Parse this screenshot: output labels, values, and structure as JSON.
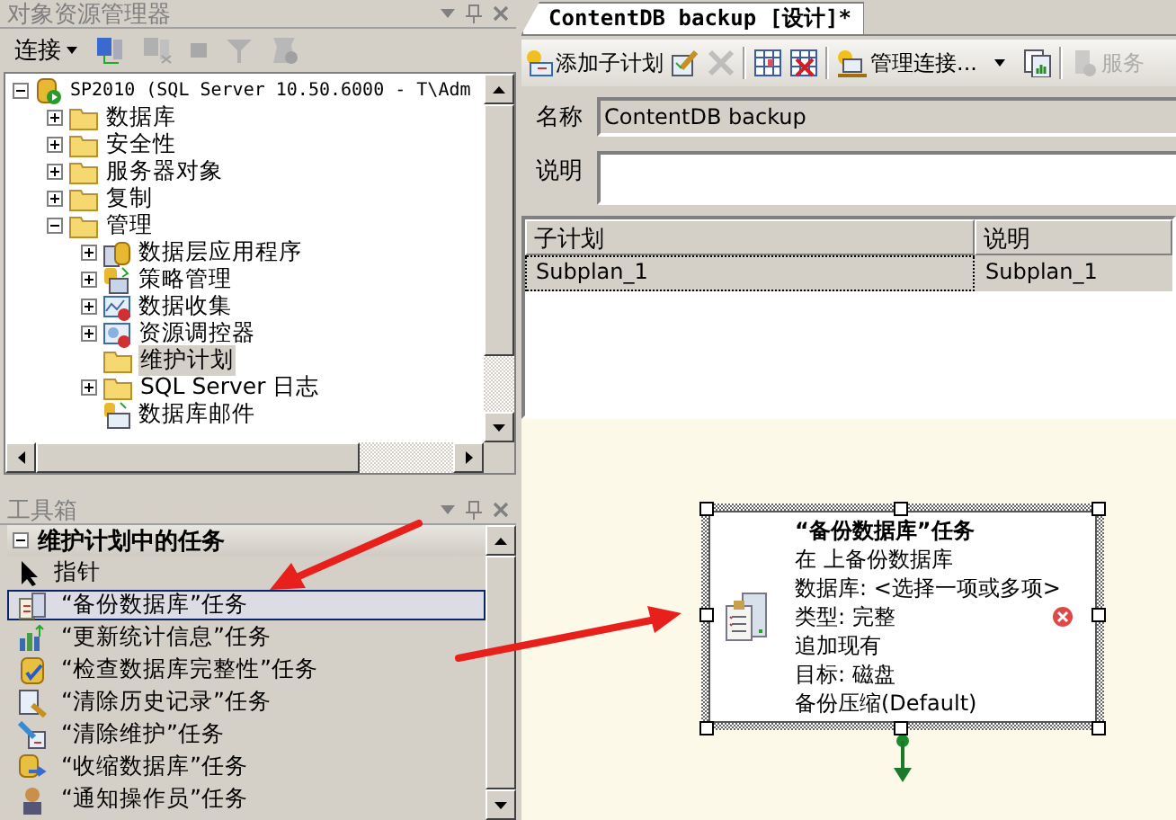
{
  "object_explorer": {
    "title": "对象资源管理器",
    "connect_button": "连接",
    "tree": [
      {
        "label": "SP2010 (SQL Server 10.50.6000 - T\\Adm",
        "kind": "server",
        "expanded": true,
        "selected": false,
        "children": [
          {
            "label": "数据库",
            "kind": "folder",
            "expanded": false,
            "selected": false
          },
          {
            "label": "安全性",
            "kind": "folder",
            "expanded": false,
            "selected": false
          },
          {
            "label": "服务器对象",
            "kind": "folder",
            "expanded": false,
            "selected": false
          },
          {
            "label": "复制",
            "kind": "folder",
            "expanded": false,
            "selected": false
          },
          {
            "label": "管理",
            "kind": "folder",
            "expanded": true,
            "selected": false,
            "children": [
              {
                "label": "数据层应用程序",
                "kind": "app",
                "expanded": false,
                "selected": false
              },
              {
                "label": "策略管理",
                "kind": "policy",
                "expanded": false,
                "selected": false
              },
              {
                "label": "数据收集",
                "kind": "collect",
                "expanded": false,
                "selected": false
              },
              {
                "label": "资源调控器",
                "kind": "governor",
                "expanded": false,
                "selected": false
              },
              {
                "label": "维护计划",
                "kind": "folder",
                "selected": true
              },
              {
                "label": "SQL Server 日志",
                "kind": "folder",
                "expanded": false,
                "selected": false
              },
              {
                "label": "数据库邮件",
                "kind": "mail",
                "selected": false
              }
            ]
          }
        ]
      }
    ]
  },
  "toolbox": {
    "title": "工具箱",
    "category": "维护计划中的任务",
    "items": [
      {
        "label": "指针",
        "kind": "pointer",
        "selected": false
      },
      {
        "label": "“备份数据库”任务",
        "kind": "backup",
        "selected": true
      },
      {
        "label": "“更新统计信息”任务",
        "kind": "stats",
        "selected": false
      },
      {
        "label": "“检查数据库完整性”任务",
        "kind": "check",
        "selected": false
      },
      {
        "label": "“清除历史记录”任务",
        "kind": "history",
        "selected": false
      },
      {
        "label": "“清除维护”任务",
        "kind": "cleanup",
        "selected": false
      },
      {
        "label": "“收缩数据库”任务",
        "kind": "shrink",
        "selected": false
      },
      {
        "label": "“通知操作员”任务",
        "kind": "notify",
        "selected": false
      }
    ]
  },
  "designer": {
    "tab": "ContentDB backup [设计]*",
    "toolbar": [
      {
        "kind": "add",
        "label": "添加子计划"
      },
      {
        "kind": "edit",
        "disabled": false
      },
      {
        "kind": "delete",
        "disabled": true
      },
      {
        "kind": "separator"
      },
      {
        "kind": "grid",
        "disabled": false
      },
      {
        "kind": "grid-delete",
        "disabled": false
      },
      {
        "kind": "separator"
      },
      {
        "kind": "connections",
        "label": "管理连接...",
        "dropdown": true
      },
      {
        "kind": "report",
        "disabled": false
      },
      {
        "kind": "separator"
      },
      {
        "kind": "service",
        "label": "服务",
        "disabled": true
      }
    ],
    "name_label": "名称",
    "name_value": "ContentDB backup",
    "description_label": "说明",
    "grid": {
      "columns": [
        "子计划",
        "说明"
      ],
      "rows": [
        [
          "Subplan_1",
          "Subplan_1"
        ]
      ]
    },
    "task": {
      "title": "“备份数据库”任务",
      "lines": [
        "在 上备份数据库",
        "数据库: <选择一项或多项>",
        "类型: 完整",
        "追加现有",
        "目标: 磁盘",
        "备份压缩(Default)"
      ],
      "error": true
    }
  }
}
